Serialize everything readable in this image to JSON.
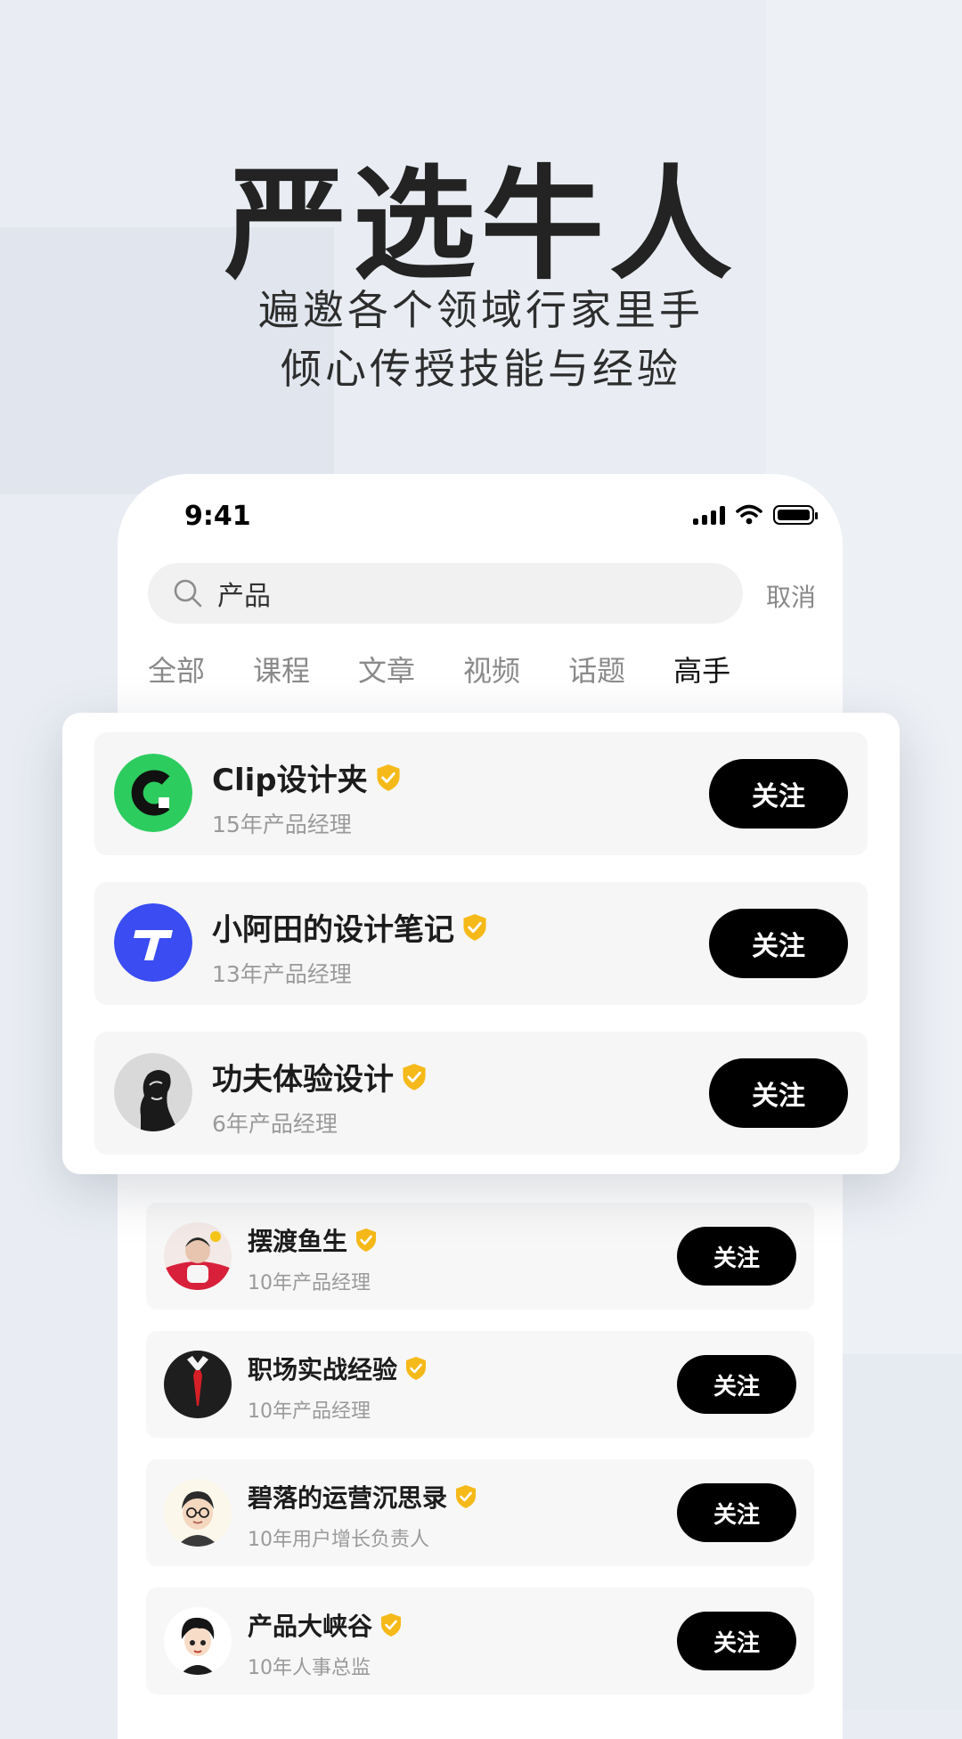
{
  "hero": {
    "title": "严选牛人",
    "subtitle_line1": "遍邀各个领域行家里手",
    "subtitle_line2": "倾心传授技能与经验"
  },
  "status_bar": {
    "time": "9:41"
  },
  "search": {
    "query": "产品",
    "cancel_label": "取消"
  },
  "tabs": [
    {
      "label": "全部"
    },
    {
      "label": "课程"
    },
    {
      "label": "文章"
    },
    {
      "label": "视频"
    },
    {
      "label": "话题"
    },
    {
      "label": "高手",
      "active": true
    }
  ],
  "featured": [
    {
      "name": "Clip设计夹",
      "desc": "15年产品经理",
      "follow_label": "关注",
      "avatar_icon": "clip-logo"
    },
    {
      "name": "小阿田的设计笔记",
      "desc": "13年产品经理",
      "follow_label": "关注",
      "avatar_icon": "t-logo"
    },
    {
      "name": "功夫体验设计",
      "desc": "6年产品经理",
      "follow_label": "关注",
      "avatar_icon": "portrait"
    }
  ],
  "list": [
    {
      "name": "摆渡鱼生",
      "desc": "10年产品经理",
      "follow_label": "关注"
    },
    {
      "name": "职场实战经验",
      "desc": "10年产品经理",
      "follow_label": "关注"
    },
    {
      "name": "碧落的运营沉思录",
      "desc": "10年用户增长负责人",
      "follow_label": "关注"
    },
    {
      "name": "产品大峡谷",
      "desc": "10年人事总监",
      "follow_label": "关注"
    }
  ],
  "colors": {
    "verified": "#f5b919",
    "button": "#000000",
    "clip_green": "#2ccc5e",
    "t_blue": "#3a4cf2"
  }
}
